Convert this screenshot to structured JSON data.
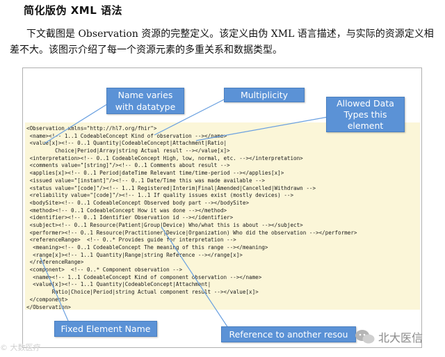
{
  "heading": "简化版伪 XML 语法",
  "paragraph": "下文截图是 Observation 资源的完整定义。该定义由伪 XML 语言描述，与实际的资源定义相差不大。该图示介绍了每一个资源元素的多重关系和数据类型。",
  "callouts": {
    "name_varies_line1": "Name varies",
    "name_varies_line2": "with datatype",
    "multiplicity": "Multiplicity",
    "allowed_line1": "Allowed Data",
    "allowed_line2": "Types this",
    "allowed_line3": "element",
    "fixed_element": "Fixed Element Name",
    "reference": "Reference to another resou"
  },
  "code_lines": [
    "<Observation xmlns=\"http://hl7.org/fhir\">",
    " <name><!-- 1..1 CodeableConcept Kind of observation --></name>",
    " <value[x]><!-- 0..1 Quantity|CodeableConcept|Attachment|Ratio|",
    "         Choice|Period|Array|string Actual result --></value[x]>",
    " <interpretation><!-- 0..1 CodeableConcept High, low, normal, etc. --></interpretation>",
    " <comments value=\"[string]\"/><!-- 0..1 Comments about result -->",
    " <applies[x]><!-- 0..1 Period|dateTime Relevant time/time-period --></applies[x]>",
    " <issued value=\"[instant]\"/><!-- 0..1 Date/Time this was made available -->",
    " <status value=\"[code]\"/><!-- 1..1 Registered|Interim|Final|Amended|Cancelled|Withdrawn -->",
    " <reliability value=\"[code]\"/><!-- 1..1 If quality issues exist (mostly devices) -->",
    " <bodySite><!-- 0..1 CodeableConcept Observed body part --></bodySite>",
    " <method><!-- 0..1 CodeableConcept How it was done --></method>",
    " <identifier><!-- 0..1 Identifier Observation id --></identifier>",
    " <subject><!-- 0..1 Resource(Patient|Group|Device) Who/what this is about --></subject>",
    " <performer><!-- 0..1 Resource(Practitioner|Device|Organization) Who did the observation --></performer>",
    " <referenceRange>  <!-- 0..* Provides guide for interpretation -->",
    "  <meaning><!-- 0..1 CodeableConcept The meaning of this range --></meaning>",
    "  <range[x]><!-- 1..1 Quantity|Range|string Reference --></range[x]>",
    " </referenceRange>",
    " <component>  <!-- 0..* Component observation -->",
    "  <name><!-- 1..1 CodeableConcept Kind of component observation --></name>",
    "  <value[x]><!-- 1..1 Quantity|CodeableConcept|Attachment|",
    "        Ratio|Choice|Period|string Actual component result --></value[x]>",
    " </component>",
    "</Observation>"
  ],
  "watermark_left": "© 大数医疗",
  "watermark_right": "北大医信",
  "colors": {
    "callout": "#5b92d6",
    "code_background": "#fbf6d8",
    "arrow": "#6aa0e0"
  }
}
